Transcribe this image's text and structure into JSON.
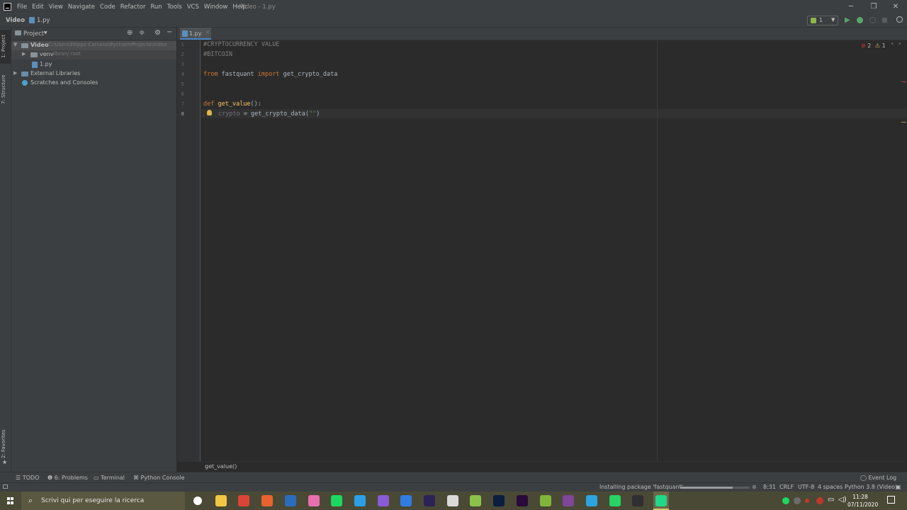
{
  "window": {
    "title": "Video - 1.py",
    "menu": [
      "File",
      "Edit",
      "View",
      "Navigate",
      "Code",
      "Refactor",
      "Run",
      "Tools",
      "VCS",
      "Window",
      "Help"
    ],
    "controls": {
      "minimize": "─",
      "restore": "❐",
      "close": "✕"
    }
  },
  "navbar": {
    "project": "Video",
    "file": "1.py",
    "run_config": "1"
  },
  "tool_stripe": {
    "project": "1: Project",
    "structure": "7: Structure",
    "favorites": "2: Favorites"
  },
  "project_panel": {
    "title": "Project",
    "tree": [
      {
        "label": "Video",
        "path": "C:\\Users\\Filippo Carcano\\PycharmProjects\\Video",
        "type": "folder"
      },
      {
        "label": "venv",
        "hint": "library root",
        "type": "folder"
      },
      {
        "label": "1.py",
        "type": "file"
      },
      {
        "label": "External Libraries",
        "type": "library"
      },
      {
        "label": "Scratches and Consoles",
        "type": "scratch"
      }
    ]
  },
  "editor": {
    "tab": "1.py",
    "line_numbers": [
      "1",
      "2",
      "3",
      "4",
      "5",
      "6",
      "7",
      "8"
    ],
    "lines": {
      "l1": "#CRYPTOCURRENCY VALUE",
      "l2": "#BITCOIN",
      "l4_kw1": "from",
      "l4_mod": " fastquant ",
      "l4_kw2": "import",
      "l4_name": " get_crypto_data",
      "l7_kw": "def",
      "l7_fn": "get_value",
      "l7_rest": "():",
      "l8_var": "crypto",
      "l8_rest": " = get_crypto_data(",
      "l8_str": "\"\"",
      "l8_end": ")"
    },
    "inspections": {
      "errors": "2",
      "warnings": "1"
    },
    "breadcrumb": "get_value()"
  },
  "bottom_tools": {
    "todo": "TODO",
    "problems": "6: Problems",
    "terminal": "Terminal",
    "python_console": "Python Console",
    "event_log": "Event Log"
  },
  "status": {
    "task": "Installing package 'fastquant'...",
    "progress": 0.75,
    "position": "8:31",
    "line_sep": "CRLF",
    "encoding": "UTF-8",
    "indent": "4 spaces",
    "interpreter": "Python 3.8 (Video)"
  },
  "taskbar": {
    "search_placeholder": "Scrivi qui per eseguire la ricerca",
    "time": "11:28",
    "date": "07/11/2020",
    "apps": [
      "settings",
      "file-explorer",
      "chrome",
      "git-client",
      "virtualbox",
      "itunes",
      "spotify",
      "vscode",
      "visual-studio",
      "wordpad",
      "eclipse",
      "cube-app",
      "notepad-plus",
      "photoshop",
      "premiere",
      "app-x",
      "tor-browser",
      "telegram",
      "whatsapp",
      "obs",
      "pycharm"
    ],
    "colors": {
      "settings": "#ffffff",
      "file-explorer": "#f2c744",
      "chrome": "#db4437",
      "git-client": "#e8632e",
      "virtualbox": "#2b6dbd",
      "itunes": "#e86fb0",
      "spotify": "#1ed760",
      "vscode": "#2d9fe6",
      "visual-studio": "#8a5bd6",
      "wordpad": "#2f7de0",
      "eclipse": "#2c2255",
      "cube-app": "#d9d9d9",
      "notepad-plus": "#8bc34a",
      "photoshop": "#0b1e3f",
      "premiere": "#2a0a3a",
      "app-x": "#7fb539",
      "tor-browser": "#7e4798",
      "telegram": "#2ca5e0",
      "whatsapp": "#25d366",
      "obs": "#302e31",
      "pycharm": "#21d789"
    }
  }
}
